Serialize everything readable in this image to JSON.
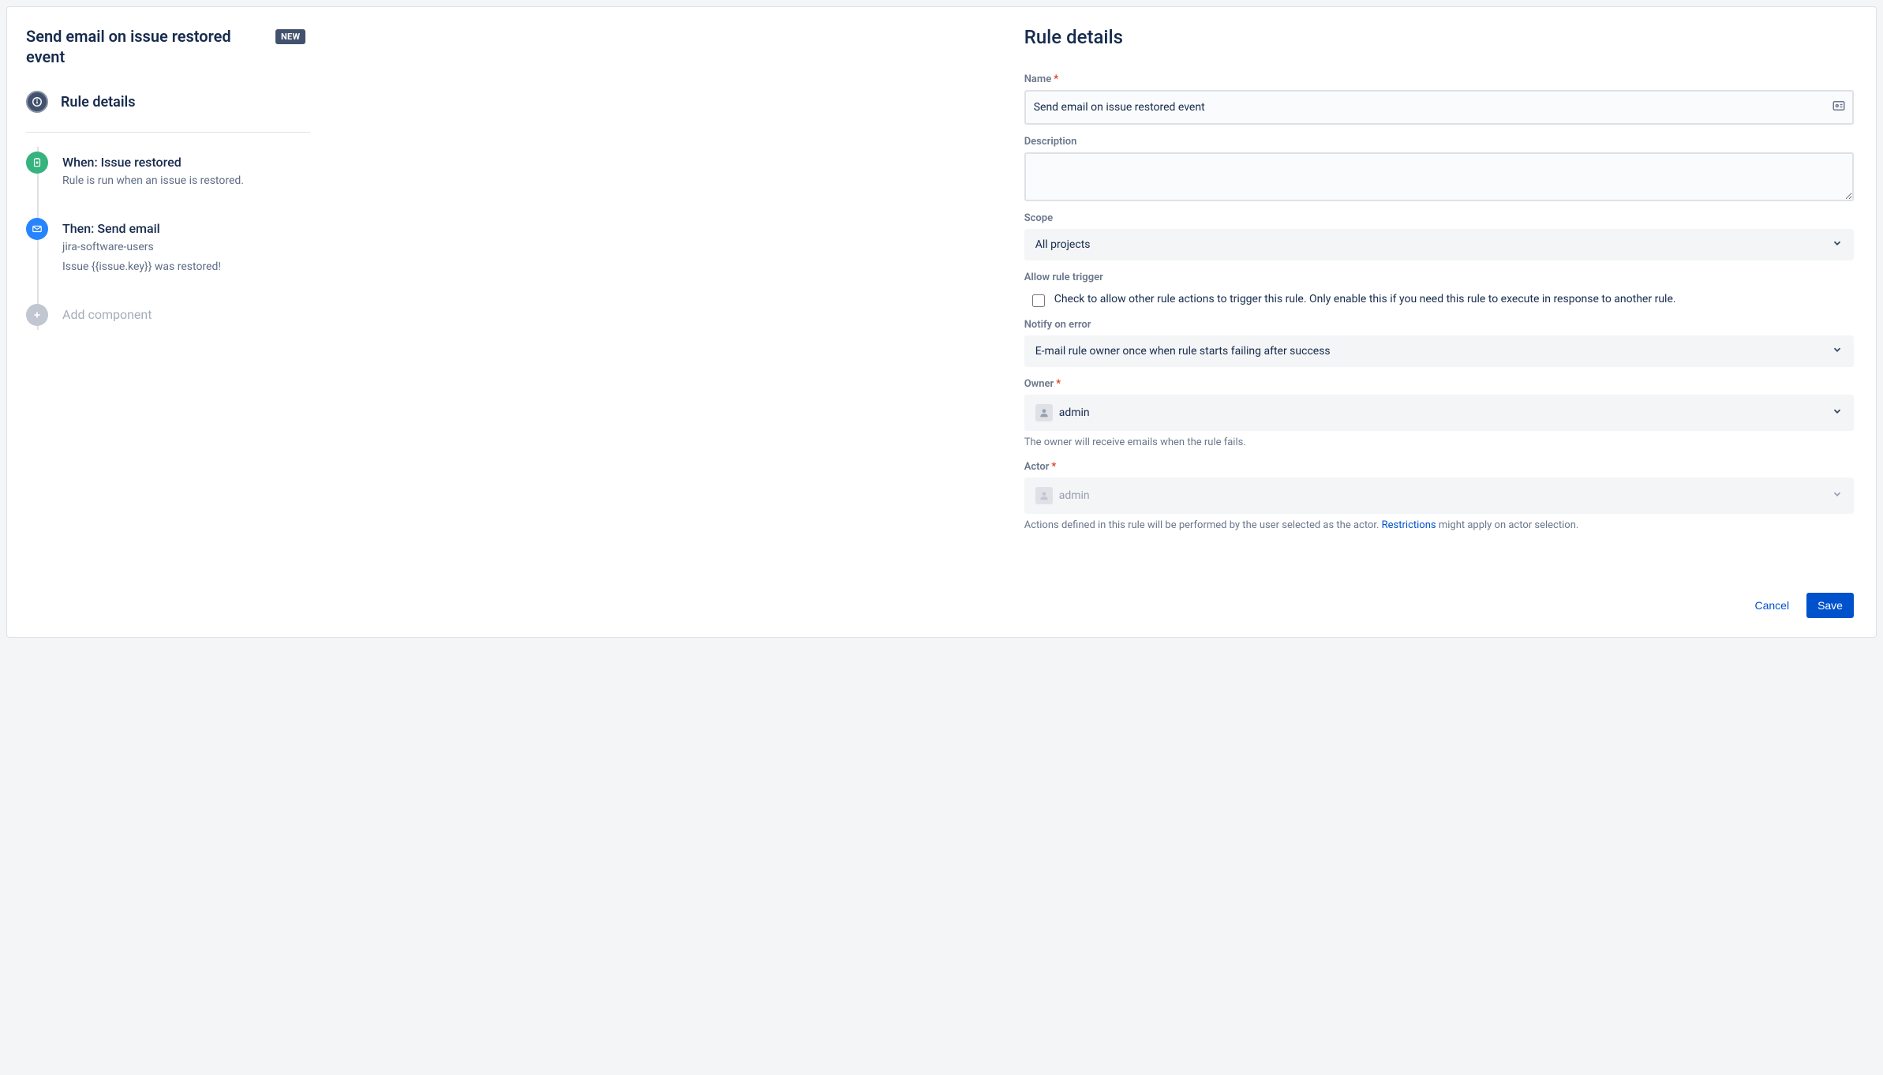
{
  "left": {
    "title": "Send email on issue restored event",
    "badge": "NEW",
    "rule_details_label": "Rule details",
    "steps": [
      {
        "id": "trigger",
        "title": "When: Issue restored",
        "body": "Rule is run when an issue is restored.",
        "icon": "clipboard-icon",
        "color": "green"
      },
      {
        "id": "action",
        "title": "Then: Send email",
        "body1": "jira-software-users",
        "body2": "Issue {{issue.key}} was restored!",
        "icon": "mail-icon",
        "color": "blue"
      }
    ],
    "add_component": "Add component"
  },
  "form": {
    "heading": "Rule details",
    "name": {
      "label": "Name",
      "value": "Send email on issue restored event"
    },
    "description": {
      "label": "Description",
      "value": ""
    },
    "scope": {
      "label": "Scope",
      "value": "All projects"
    },
    "allow_trigger": {
      "label": "Allow rule trigger",
      "checked": false,
      "text": "Check to allow other rule actions to trigger this rule. Only enable this if you need this rule to execute in response to another rule."
    },
    "notify_on_error": {
      "label": "Notify on error",
      "value": "E-mail rule owner once when rule starts failing after success"
    },
    "owner": {
      "label": "Owner",
      "value": "admin",
      "help": "The owner will receive emails when the rule fails."
    },
    "actor": {
      "label": "Actor",
      "value": "admin",
      "help_pre": "Actions defined in this rule will be performed by the user selected as the actor. ",
      "restrictions_link": "Restrictions",
      "help_post": " might apply on actor selection."
    },
    "buttons": {
      "cancel": "Cancel",
      "save": "Save"
    }
  }
}
